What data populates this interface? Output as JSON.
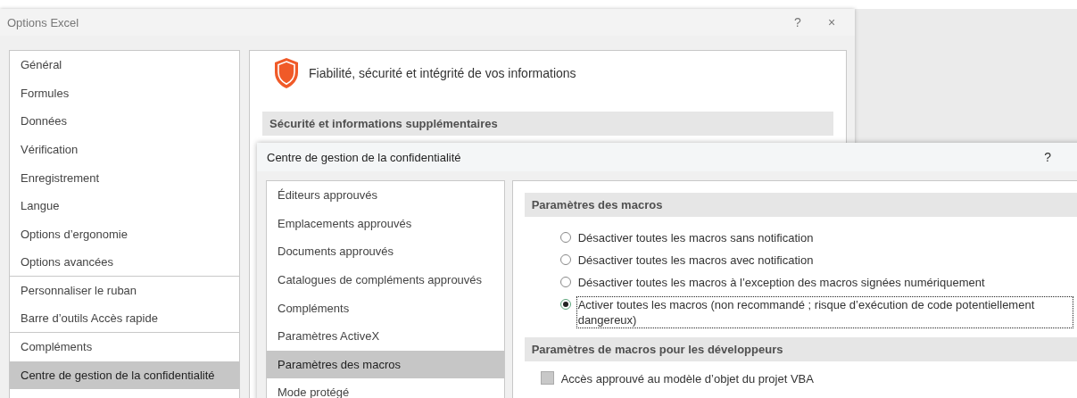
{
  "window": {
    "title": "Options Excel",
    "help": "?",
    "close": "×"
  },
  "sidebar": {
    "groups": [
      {
        "items": [
          {
            "label": "Général",
            "selected": false
          },
          {
            "label": "Formules",
            "selected": false
          },
          {
            "label": "Données",
            "selected": false
          },
          {
            "label": "Vérification",
            "selected": false
          },
          {
            "label": "Enregistrement",
            "selected": false
          },
          {
            "label": "Langue",
            "selected": false
          },
          {
            "label": "Options d’ergonomie",
            "selected": false
          },
          {
            "label": "Options avancées",
            "selected": false
          }
        ]
      },
      {
        "items": [
          {
            "label": "Personnaliser le ruban",
            "selected": false
          },
          {
            "label": "Barre d’outils Accès rapide",
            "selected": false
          }
        ]
      },
      {
        "items": [
          {
            "label": "Compléments",
            "selected": false
          },
          {
            "label": "Centre de gestion de la confidentialité",
            "selected": true
          }
        ]
      }
    ]
  },
  "main": {
    "heading": "Fiabilité, sécurité et intégrité de vos informations",
    "section": "Sécurité et informations supplémentaires"
  },
  "dialog": {
    "title": "Centre de gestion de la confidentialité",
    "help": "?",
    "sidebar": {
      "items": [
        {
          "label": "Éditeurs approuvés",
          "selected": false
        },
        {
          "label": "Emplacements approuvés",
          "selected": false
        },
        {
          "label": "Documents approuvés",
          "selected": false
        },
        {
          "label": "Catalogues de compléments approuvés",
          "selected": false
        },
        {
          "label": "Compléments",
          "selected": false
        },
        {
          "label": "Paramètres ActiveX",
          "selected": false
        },
        {
          "label": "Paramètres des macros",
          "selected": true
        },
        {
          "label": "Mode protégé",
          "selected": false
        }
      ]
    },
    "sections": [
      {
        "title": "Paramètres des macros",
        "options": [
          {
            "kind": "radio",
            "label": "Désactiver toutes les macros sans notification",
            "selected": false,
            "focused": false
          },
          {
            "kind": "radio",
            "label": "Désactiver toutes les macros avec notification",
            "selected": false,
            "focused": false
          },
          {
            "kind": "radio",
            "label": "Désactiver toutes les macros à l’exception des macros signées numériquement",
            "selected": false,
            "focused": false
          },
          {
            "kind": "radio",
            "label": "Activer toutes les macros (non recommandé ; risque d’exécution de code potentiellement dangereux)",
            "selected": true,
            "focused": true
          }
        ]
      },
      {
        "title": "Paramètres de macros pour les développeurs",
        "options": [
          {
            "kind": "checkbox",
            "label": "Accès approuvé au modèle d’objet du projet VBA",
            "checked": false,
            "disabled": true
          }
        ]
      }
    ]
  }
}
